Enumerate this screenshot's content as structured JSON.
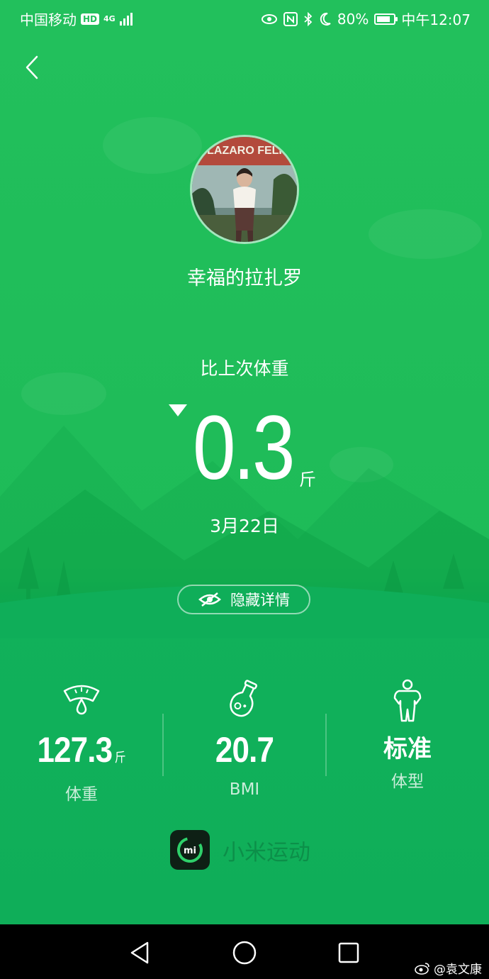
{
  "status_bar": {
    "carrier": "中国移动",
    "hd_badge": "HD",
    "network": "4G",
    "battery_percent": "80%",
    "battery_level": 0.8,
    "time": "中午12:07"
  },
  "profile": {
    "username": "幸福的拉扎罗",
    "avatar_text": "LAZARO FELI"
  },
  "weight_change": {
    "label": "比上次体重",
    "direction": "down",
    "value": "0.3",
    "unit": "斤",
    "date": "3月22日"
  },
  "hide_details_label": "隐藏详情",
  "stats": {
    "weight": {
      "value": "127.3",
      "unit": "斤",
      "label": "体重"
    },
    "bmi": {
      "value": "20.7",
      "label": "BMI"
    },
    "body_type": {
      "value": "标准",
      "label": "体型"
    }
  },
  "brand": {
    "name": "小米运动",
    "logo_text": "mi"
  },
  "watermark": "@袁文康",
  "colors": {
    "primary_green": "#1ebb58",
    "nav_bar": "#000000"
  }
}
